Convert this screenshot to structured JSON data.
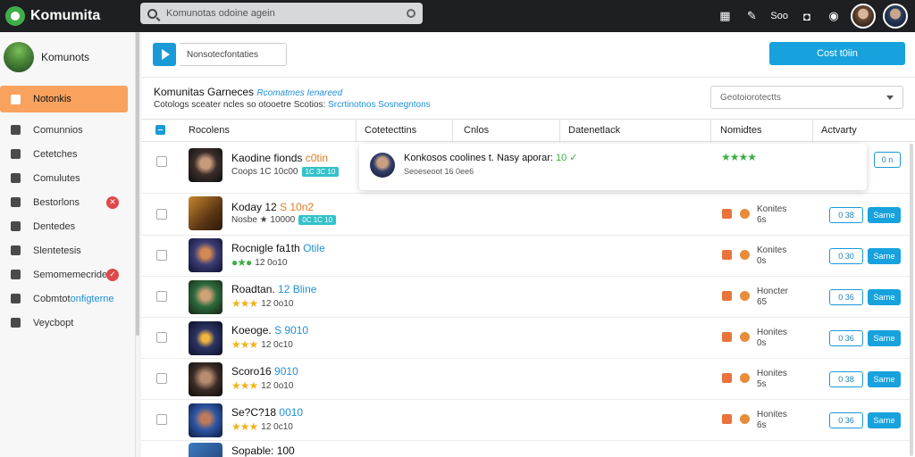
{
  "app": {
    "name": "Komumita"
  },
  "search": {
    "value": "Komunotas odoine agein"
  },
  "topbar": {
    "label": "Soo"
  },
  "sidebar": {
    "profile_name": "Komunots",
    "items": [
      {
        "label": "Notonkis"
      },
      {
        "label": "Comunnios"
      },
      {
        "label": "Cetetches"
      },
      {
        "label": "Comulutes"
      },
      {
        "label": "Bestorlons"
      },
      {
        "label": "Dentedes"
      },
      {
        "label": "Slentetesis"
      },
      {
        "label": "Semomemecrider"
      },
      {
        "label_plain": "Cobmtot",
        "label_hl": "onfigterne"
      },
      {
        "label": "Veycbopt"
      }
    ]
  },
  "toolbar": {
    "path": "Nonsotecfontaties",
    "primary_button": "Cost t0iin"
  },
  "heading": {
    "title": "Komunitas Garneces",
    "title_accent": "Rcomatmes Ienareed"
  },
  "subheading": {
    "text": "Cotologs sceater ncles so otooetre Scotios:",
    "accent1": "Srcrtinotnos",
    "accent2": "Sosnegntons"
  },
  "filter": {
    "placeholder": "Geotoiorotectts"
  },
  "table": {
    "headers": [
      "Rocolens",
      "Cotetecttins",
      "Cnlos",
      "Datenetlack",
      "Nomidtes",
      "Actvarty"
    ]
  },
  "popup": {
    "title": "Konkosos coolines t. Nasy aporar:",
    "title_hl": "10",
    "sub": "Seoeseoot  16 0ee6",
    "stars": "★★★★"
  },
  "rows": [
    {
      "title": "Kaodine fionds",
      "title_hl": "c0tin",
      "sub": "Coops  1C 10c00",
      "chip": "1C 3C 10"
    },
    {
      "title": "Koday  12",
      "title_hl": "S 10n2",
      "sub": "Nosbe  ★  10000",
      "chip": "0C 1C 10"
    },
    {
      "title": "Rocnigle fa1th",
      "title_hl": "Otile",
      "sub": "12  0o10",
      "stars": "●★●"
    },
    {
      "title": "Roadtan.",
      "title_hl": "12 Bline",
      "sub": "12  0o10",
      "stars": "★★★"
    },
    {
      "title": "Koeoge.",
      "title_hl": "S 9010",
      "sub": "12  0c10",
      "stars": "★★★"
    },
    {
      "title": "Scoro16",
      "title_hl": "9010",
      "sub": "12  0o10",
      "stars": "★★★"
    },
    {
      "title": "Se?C?18",
      "title_hl": "0010",
      "sub": "12  0c10",
      "stars": "★★★"
    },
    {
      "title": "Sopable:  100",
      "title_hl": "",
      "sub": "",
      "stars": ""
    }
  ],
  "row_side": [
    {
      "line1": "Konites",
      "line2": "6s",
      "outline": "0 38",
      "fill": "Sarne"
    },
    {
      "line1": "Konites",
      "line2": "0s",
      "outline": "0 30",
      "fill": "Sarne"
    },
    {
      "line1": "Honcter",
      "line2": "65",
      "outline": "0 36",
      "fill": "Sarne"
    },
    {
      "line1": "Honites",
      "line2": "0s",
      "outline": "0 36",
      "fill": "Sarne"
    },
    {
      "line1": "Honites",
      "line2": "5s",
      "outline": "0 38",
      "fill": "Sarne"
    },
    {
      "line1": "Honites",
      "line2": "6s",
      "outline": "0 36",
      "fill": "Sarne"
    }
  ],
  "row1_button": "0 n",
  "colors": {
    "accent": "#18a2dd",
    "active_nav": "#f9a25e",
    "topbar": "#1e1f22"
  }
}
